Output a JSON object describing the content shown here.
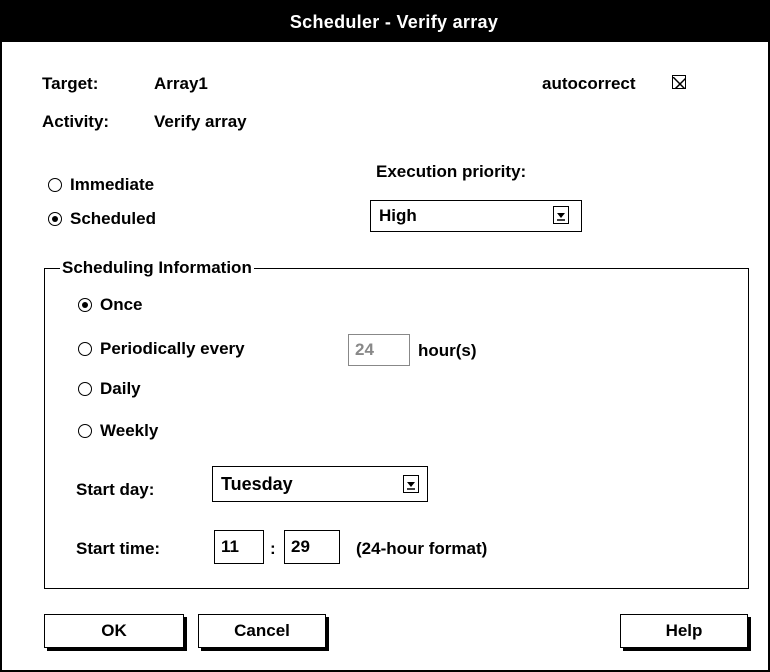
{
  "window": {
    "title": "Scheduler - Verify array"
  },
  "info": {
    "target_label": "Target:",
    "target_value": "Array1",
    "activity_label": "Activity:",
    "activity_value": "Verify array",
    "autocorrect_label": "autocorrect",
    "autocorrect_checked": true
  },
  "mode": {
    "immediate_label": "Immediate",
    "scheduled_label": "Scheduled",
    "selected": "Scheduled"
  },
  "priority": {
    "label": "Execution priority:",
    "value": "High"
  },
  "scheduling": {
    "group_title": "Scheduling Information",
    "once_label": "Once",
    "periodically_label": "Periodically every",
    "period_value": "24",
    "period_unit": "hour(s)",
    "daily_label": "Daily",
    "weekly_label": "Weekly",
    "selected": "Once",
    "start_day_label": "Start day:",
    "start_day_value": "Tuesday",
    "start_time_label": "Start time:",
    "start_hour": "11",
    "time_separator": ":",
    "start_minute": "29",
    "time_format_note": "(24-hour format)"
  },
  "buttons": {
    "ok": "OK",
    "cancel": "Cancel",
    "help": "Help"
  }
}
